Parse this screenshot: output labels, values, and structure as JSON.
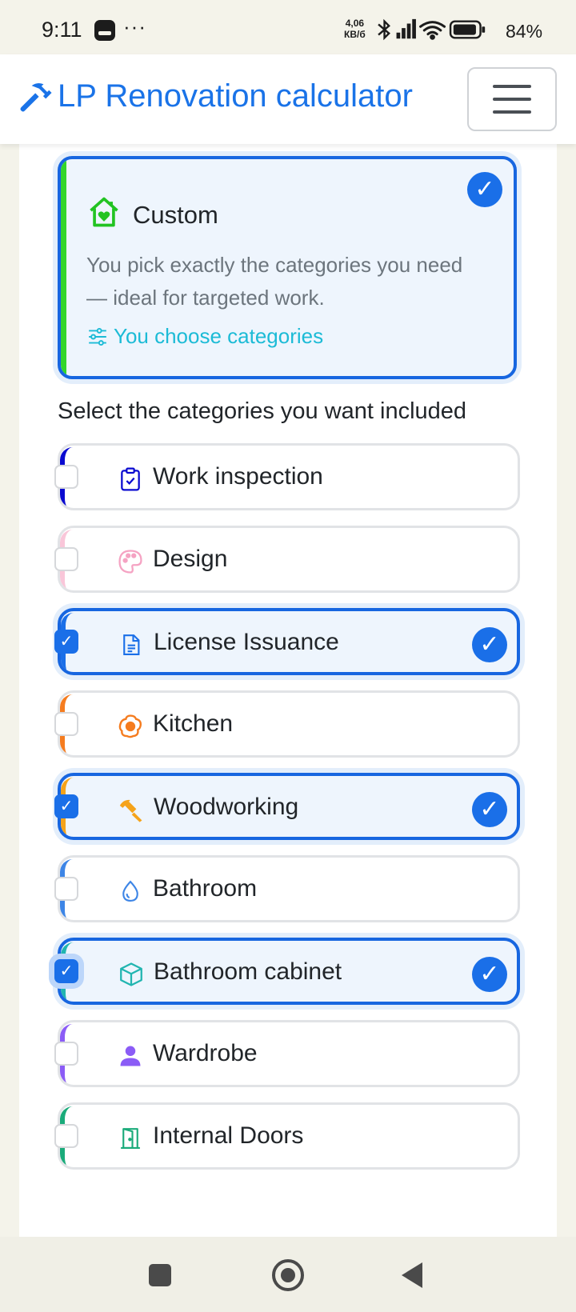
{
  "status_bar": {
    "time": "9:11",
    "more": "···",
    "speed_value": "4,06",
    "speed_unit": "КВ/б",
    "battery_percent": "84%"
  },
  "header": {
    "brand_title": "LP Renovation calculator",
    "brand_icon": "hammer-icon",
    "menu_icon": "hamburger-menu-icon"
  },
  "plan": {
    "title": "Custom",
    "description": "You pick exactly the categories you need — ideal for targeted work.",
    "link_text": "You choose categories",
    "selected": true,
    "accent_color": "#33d62a"
  },
  "section": {
    "heading": "Select the categories you want included"
  },
  "categories": [
    {
      "label": "Work inspection",
      "icon": "clipboard-check-icon",
      "color": "#0a0ad0",
      "selected": false
    },
    {
      "label": "Design",
      "icon": "palette-icon",
      "color": "#f9c6d9",
      "selected": false
    },
    {
      "label": "License Issuance",
      "icon": "document-icon",
      "color": "#1a6fe8",
      "selected": true
    },
    {
      "label": "Kitchen",
      "icon": "egg-icon",
      "color": "#f57c1f",
      "selected": false
    },
    {
      "label": "Woodworking",
      "icon": "hammer-icon",
      "color": "#f5a31a",
      "selected": true
    },
    {
      "label": "Bathroom",
      "icon": "droplet-icon",
      "color": "#3d85e6",
      "selected": false
    },
    {
      "label": "Bathroom cabinet",
      "icon": "box-icon",
      "color": "#21b5b0",
      "selected": true
    },
    {
      "label": "Wardrobe",
      "icon": "person-icon",
      "color": "#8b5cf6",
      "selected": false
    },
    {
      "label": "Internal Doors",
      "icon": "door-icon",
      "color": "#1aab7a",
      "selected": false
    }
  ],
  "check_glyph": "✓",
  "accent_color": "#1a6fe8"
}
